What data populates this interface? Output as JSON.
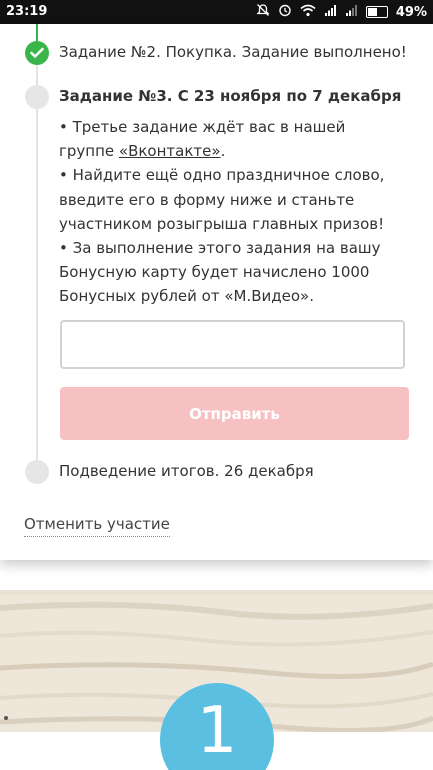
{
  "status_bar": {
    "time": "23:19",
    "battery_percent": "49%",
    "icons": [
      "mute-icon",
      "alarm-icon",
      "wifi-icon",
      "signal-icon",
      "signal-icon",
      "battery-icon"
    ]
  },
  "steps": {
    "step2": {
      "text": "Задание №2. Покупка. Задание выполнено!",
      "state": "done"
    },
    "step3": {
      "title": "Задание №3. С 23 ноября по 7 декабря",
      "line1_pre": "• Третье задание ждёт вас в нашей группе",
      "vk_link": "«Вконтакте»",
      "line1_post": ".",
      "line2": "• Найдите ещё одно праздничное слово, введите его в форму ниже и станьте участником розыгрыша главных призов!",
      "line3": "• За выполнение этого задания на вашу Бонусную карту будет начислено 1000 Бонусных рублей от «М.Видео».",
      "input_value": "",
      "input_placeholder": "",
      "submit_label": "Отправить"
    },
    "step4": {
      "text": "Подведение итогов. 26 декабря"
    }
  },
  "cancel_label": "Отменить участие",
  "badge_number": "1",
  "colors": {
    "done_green": "#3ab54a",
    "submit_disabled": "#f7c1c3",
    "badge_blue": "#5bbfe2",
    "timeline_grey": "#e6e6e6"
  }
}
